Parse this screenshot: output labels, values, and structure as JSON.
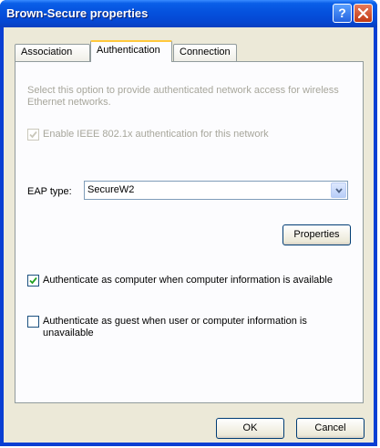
{
  "window": {
    "title": "Brown-Secure properties",
    "help_glyph": "?"
  },
  "tabs": [
    {
      "label": "Association"
    },
    {
      "label": "Authentication"
    },
    {
      "label": "Connection"
    }
  ],
  "auth": {
    "description": "Select this option to provide authenticated network access for wireless Ethernet networks.",
    "enable_8021x": {
      "label": "Enable IEEE 802.1x authentication for this network",
      "checked": true,
      "disabled": true
    },
    "eap_type_label": "EAP type:",
    "eap_type_value": "SecureW2",
    "properties_button": "Properties",
    "auth_as_computer": {
      "label": "Authenticate as computer when computer information is available",
      "checked": true
    },
    "auth_as_guest": {
      "label": "Authenticate as guest when user or computer information is unavailable",
      "checked": false
    }
  },
  "footer": {
    "ok_label": "OK",
    "cancel_label": "Cancel"
  },
  "colors": {
    "titlebar": "#0551dd",
    "dialog_bg": "#ece9d8",
    "check_green": "#21a121",
    "active_tab_accent": "#ffc83c"
  }
}
